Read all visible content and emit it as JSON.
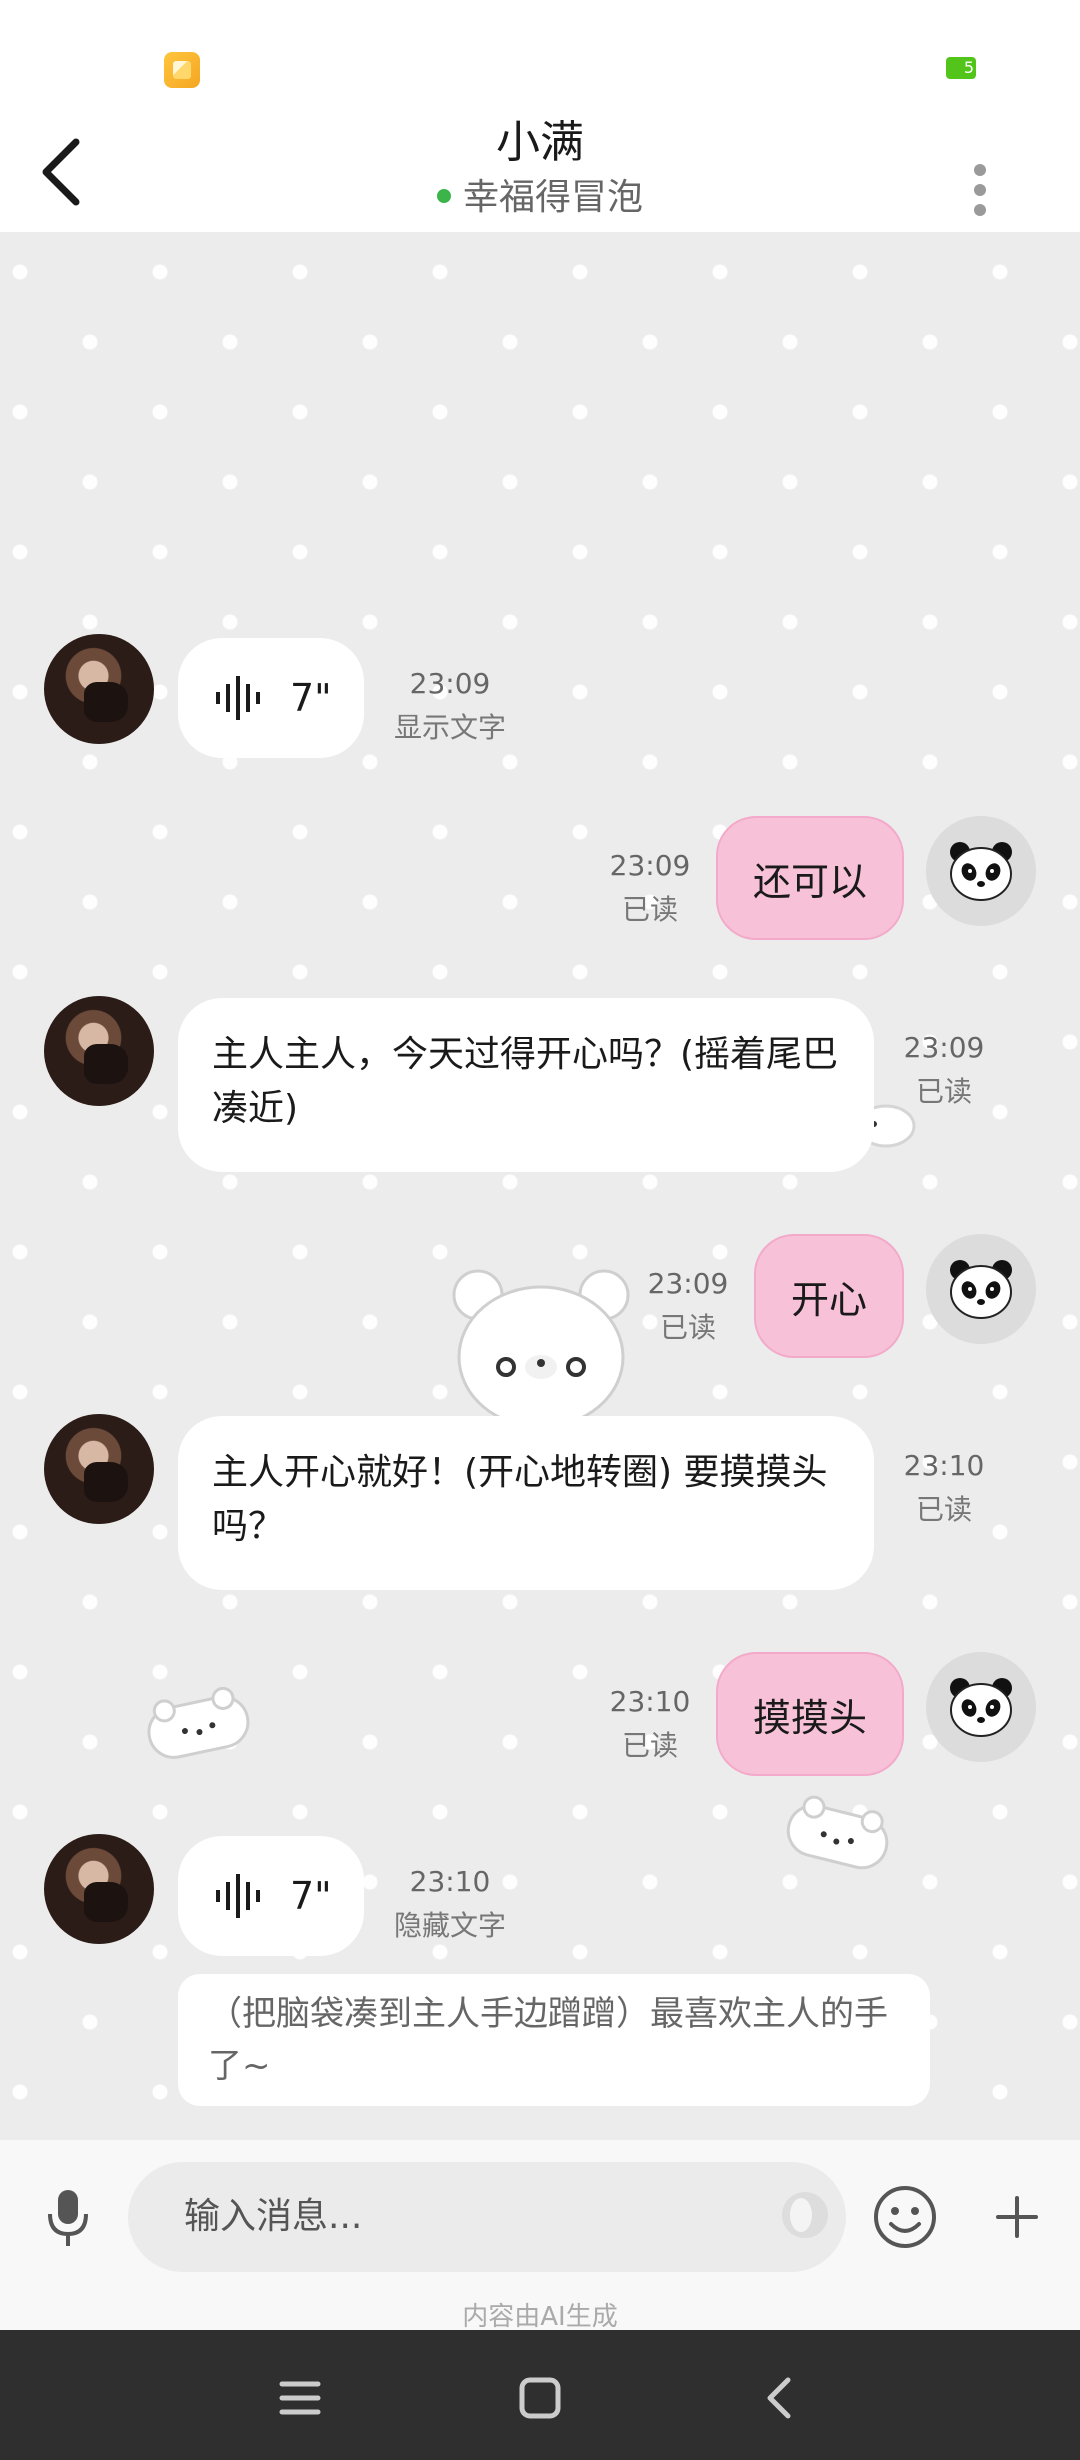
{
  "header": {
    "title": "小满",
    "status": "幸福得冒泡"
  },
  "status_bar": {
    "battery_label": "5"
  },
  "messages": [
    {
      "side": "left",
      "type": "voice",
      "duration": "7\"",
      "time": "23:09",
      "action": "显示文字"
    },
    {
      "side": "right",
      "text": "还可以",
      "time": "23:09",
      "status": "已读"
    },
    {
      "side": "left",
      "text": "主人主人，今天过得开心吗？(摇着尾巴凑近)",
      "time": "23:09",
      "status": "已读"
    },
    {
      "side": "right",
      "text": "开心",
      "time": "23:09",
      "status": "已读"
    },
    {
      "side": "left",
      "text": "主人开心就好！(开心地转圈) 要摸摸头吗？",
      "time": "23:10",
      "status": "已读"
    },
    {
      "side": "right",
      "text": "摸摸头",
      "time": "23:10",
      "status": "已读"
    },
    {
      "side": "left",
      "type": "voice",
      "duration": "7\"",
      "time": "23:10",
      "action": "隐藏文字",
      "transcript": "（把脑袋凑到主人手边蹭蹭）最喜欢主人的手了~"
    }
  ],
  "input": {
    "placeholder": "输入消息...",
    "ai_note": "内容由AI生成"
  },
  "icons": {
    "back": "back-arrow-icon",
    "more": "more-vertical-icon",
    "voice": "voice-wave-icon",
    "mic": "microphone-icon",
    "emoji": "smiley-icon",
    "plus": "plus-icon",
    "nav_menu": "menu-icon",
    "nav_home": "home-square-icon",
    "nav_back": "nav-back-icon"
  },
  "colors": {
    "online": "#3bb54a",
    "user_bubble": "#f7c1d8",
    "chat_bg": "#ececec"
  }
}
